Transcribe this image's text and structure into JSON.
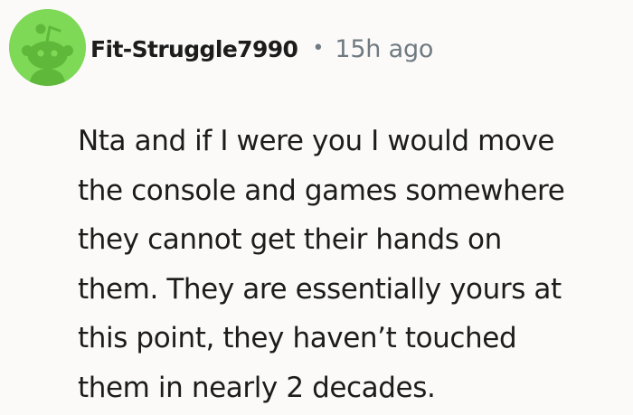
{
  "comment": {
    "author": "Fit-Struggle7990",
    "separator": "•",
    "timestamp": "15h ago",
    "avatar_icon": "reddit-snoo-avatar-icon",
    "avatar_color": "#7ed957",
    "body_lines": [
      "Nta and if I were you I would move",
      "the console and games somewhere",
      "they cannot get their hands on",
      "them. They are essentially yours at",
      "this point, they haven’t touched",
      "them in nearly 2 decades."
    ]
  }
}
